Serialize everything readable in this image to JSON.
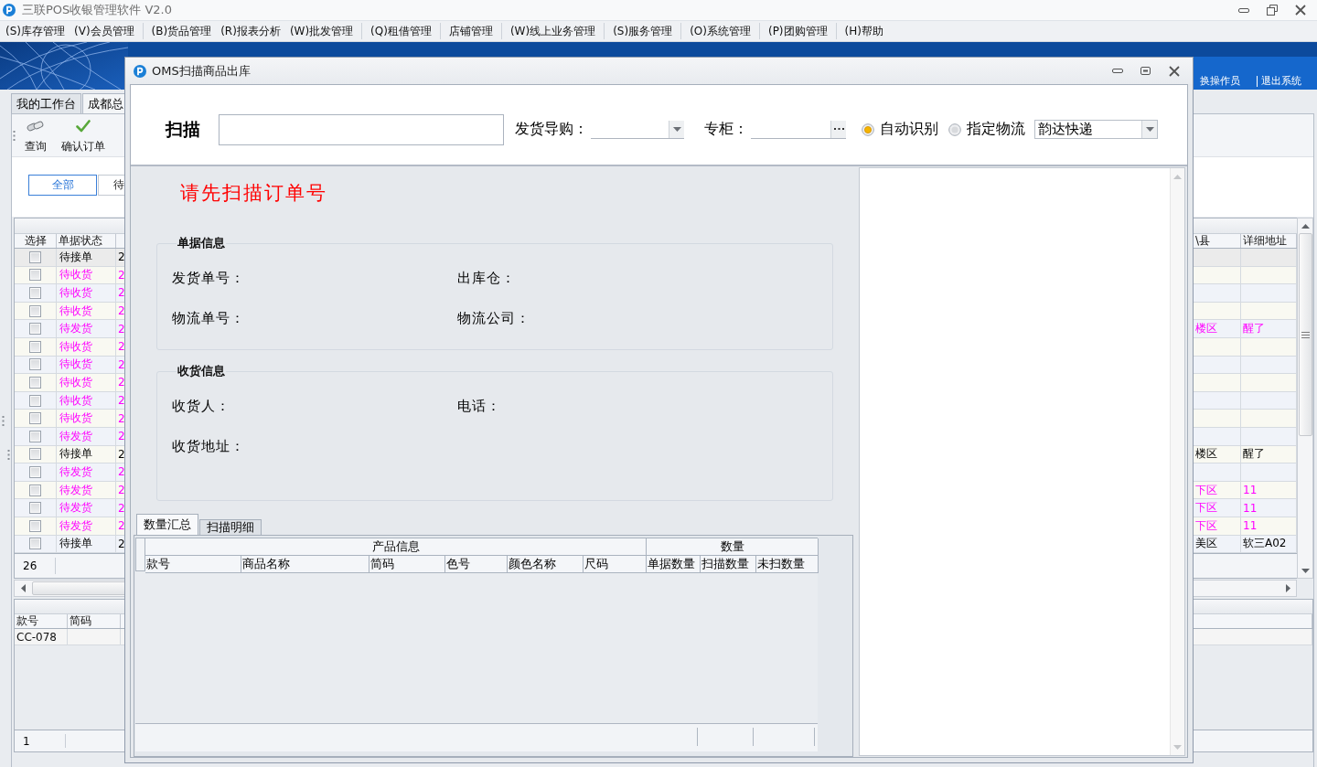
{
  "app_window": {
    "title": "三联POS收银管理软件 V2.0"
  },
  "menu_bar": [
    [
      "(S)库存管理",
      "(V)会员管理"
    ],
    [
      "(B)货品管理",
      "(R)报表分析",
      "(W)批发管理"
    ],
    [
      "(Q)租借管理"
    ],
    [
      "店铺管理"
    ],
    [
      "(W)线上业务管理"
    ],
    [
      "(S)服务管理"
    ],
    [
      "(O)系统管理"
    ],
    [
      "(P)团购管理"
    ],
    [
      "(H)帮助"
    ]
  ],
  "header_links": [
    "换操作员",
    "退出系统"
  ],
  "workspace_tabs": [
    {
      "label": "我的工作台",
      "selected": false
    },
    {
      "label": "成都总",
      "selected": true
    }
  ],
  "toolbar": [
    "查询",
    "确认订单"
  ],
  "status_filters": [
    {
      "label": "全部",
      "selected": true
    },
    {
      "label": "待",
      "selected": false
    }
  ],
  "orders_table": {
    "columns": [
      "选择",
      "单据状态"
    ],
    "right_columns": [
      "\\县",
      "详细地址"
    ],
    "rows": [
      {
        "checked": false,
        "selected": true,
        "status": "待接单",
        "highlighted": false,
        "column_3": "2"
      },
      {
        "checked": false,
        "selected": false,
        "status": "待收货",
        "highlighted": true,
        "column_3": "2"
      },
      {
        "checked": false,
        "selected": false,
        "status": "待收货",
        "highlighted": true,
        "column_3": "2"
      },
      {
        "checked": false,
        "selected": false,
        "status": "待收货",
        "highlighted": true,
        "column_3": "2"
      },
      {
        "checked": false,
        "selected": false,
        "status": "待发货",
        "highlighted": true,
        "column_3": "2",
        "district": "楼区",
        "address": "醒了"
      },
      {
        "checked": false,
        "selected": false,
        "status": "待收货",
        "highlighted": true,
        "column_3": "2"
      },
      {
        "checked": false,
        "selected": false,
        "status": "待收货",
        "highlighted": true,
        "column_3": "2"
      },
      {
        "checked": false,
        "selected": false,
        "status": "待收货",
        "highlighted": true,
        "column_3": "2"
      },
      {
        "checked": false,
        "selected": false,
        "status": "待收货",
        "highlighted": true,
        "column_3": "2"
      },
      {
        "checked": false,
        "selected": false,
        "status": "待收货",
        "highlighted": true,
        "column_3": "2"
      },
      {
        "checked": false,
        "selected": false,
        "status": "待发货",
        "highlighted": true,
        "column_3": "2"
      },
      {
        "checked": false,
        "selected": false,
        "status": "待接单",
        "highlighted": false,
        "column_3": "2",
        "district": "楼区",
        "address": "醒了"
      },
      {
        "checked": false,
        "selected": false,
        "status": "待发货",
        "highlighted": true,
        "column_3": "2"
      },
      {
        "checked": false,
        "selected": false,
        "status": "待发货",
        "highlighted": true,
        "column_3": "2",
        "district": "下区",
        "address": "11"
      },
      {
        "checked": false,
        "selected": false,
        "status": "待发货",
        "highlighted": true,
        "column_3": "2",
        "district": "下区",
        "address": "11"
      },
      {
        "checked": false,
        "selected": false,
        "status": "待发货",
        "highlighted": true,
        "column_3": "2",
        "district": "下区",
        "address": "11"
      },
      {
        "checked": false,
        "selected": false,
        "status": "待接单",
        "highlighted": false,
        "column_3": "2",
        "district": "美区",
        "address": "软三A02"
      }
    ],
    "footer": "26"
  },
  "items_table": {
    "columns": [
      "款号",
      "简码"
    ],
    "rows": [
      {
        "style_no": "CC-078"
      }
    ],
    "footer": "1"
  },
  "dialog": {
    "title": "OMS扫描商品出库",
    "scan_label": "扫描",
    "sales_guide_label": "发货导购：",
    "counter_label": "专柜：",
    "logistics_mode": [
      {
        "label": "自动识别",
        "selected": true
      },
      {
        "label": "指定物流",
        "selected": false
      }
    ],
    "carrier": "韵达快递",
    "prompt": "请先扫描订单号",
    "groups": [
      {
        "title": "单据信息",
        "fields": [
          "发货单号：",
          "出库仓：",
          "物流单号：",
          "物流公司："
        ]
      },
      {
        "title": "收货信息",
        "fields": [
          "收货人：",
          "电话：",
          "收货地址："
        ]
      }
    ],
    "tabs": [
      {
        "label": "数量汇总",
        "selected": true
      },
      {
        "label": "扫描明细",
        "selected": false
      }
    ],
    "summary_table": {
      "column_groups": [
        {
          "label": "产品信息",
          "columns": [
            "款号",
            "商品名称",
            "简码",
            "色号",
            "颜色名称",
            "尺码"
          ]
        },
        {
          "label": "数量",
          "columns": [
            "单据数量",
            "扫描数量",
            "未扫数量"
          ]
        }
      ]
    }
  }
}
